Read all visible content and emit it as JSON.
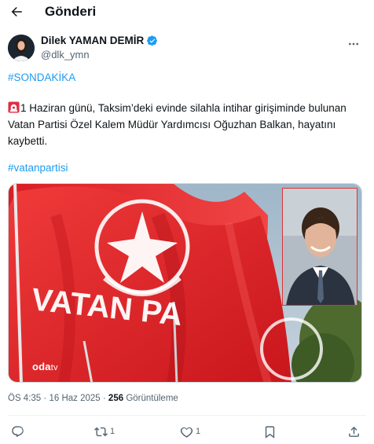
{
  "header": {
    "title": "Gönderi"
  },
  "author": {
    "name": "Dilek YAMAN DEMİR",
    "handle": "@dlk_ymn"
  },
  "tweet": {
    "hashtag_top": "#SONDAKİKA",
    "body": "1 Haziran günü, Taksim’deki evinde silahla intihar girişiminde bulunan Vatan Partisi Özel Kalem Müdür Yardımcısı Oğuzhan Balkan, hayatını kaybetti.",
    "hashtag_bottom": "#vatanpartisi",
    "emoji": "siren-emoji"
  },
  "media": {
    "watermark_main": "oda",
    "watermark_sub": "tv",
    "flag_text": "VATAN PA"
  },
  "meta": {
    "time": "ÖS 4:35",
    "separator": "·",
    "date": "16 Haz 2025",
    "views_count": "256",
    "views_label": "Görüntüleme"
  },
  "actions": {
    "replies": "",
    "reposts": "1",
    "likes": "1"
  },
  "colors": {
    "accent": "#1d9bf0",
    "verified": "#1d9bf0",
    "flag_red": "#e0252b"
  },
  "icons": [
    "back-arrow-icon",
    "more-icon",
    "verified-badge-icon",
    "reply-icon",
    "repost-icon",
    "like-icon",
    "bookmark-icon",
    "share-icon"
  ]
}
